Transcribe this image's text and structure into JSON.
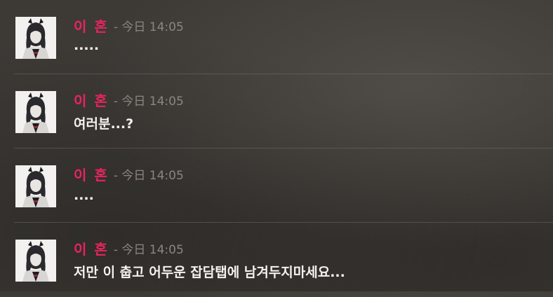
{
  "messages": [
    {
      "author": "이 혼",
      "time": "- 今日 14:05",
      "text": "....."
    },
    {
      "author": "이 혼",
      "time": "- 今日 14:05",
      "text": "여러분...?"
    },
    {
      "author": "이 혼",
      "time": "- 今日 14:05",
      "text": "...."
    },
    {
      "author": "이 혼",
      "time": "- 今日 14:05",
      "text": "저만 이 춥고 어두운 잡담탭에 남겨두지마세요..."
    }
  ],
  "colors": {
    "author": "#e8245e",
    "timestamp": "#8a8680",
    "text": "#f4f2ef",
    "background": "#3d3a36"
  }
}
